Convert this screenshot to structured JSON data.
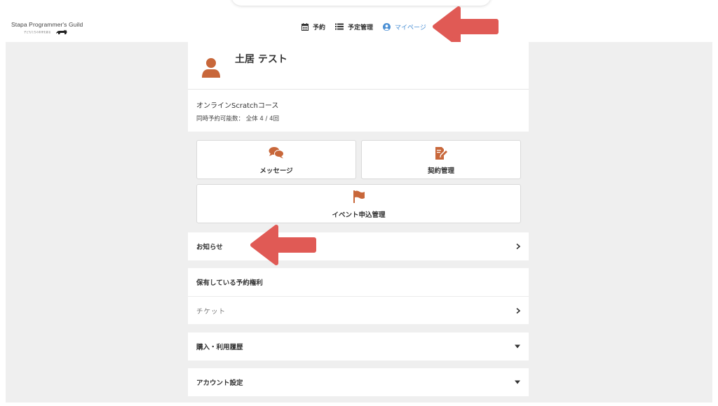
{
  "header": {
    "logo_text": "Stapa Programmer's Guild",
    "logo_sub": "子どもたちの未来を創る",
    "nav": [
      {
        "label": "予約",
        "icon": "calendar-icon"
      },
      {
        "label": "予定管理",
        "icon": "list-icon"
      },
      {
        "label": "マイページ",
        "icon": "user-circle-icon"
      }
    ]
  },
  "profile": {
    "name": "土居 テスト",
    "course": "オンラインScratchコース",
    "limit": "同時予約可能数： 全体 4 / 4回"
  },
  "tiles": [
    {
      "label": "メッセージ",
      "icon": "chat-bubbles-icon"
    },
    {
      "label": "契約管理",
      "icon": "contract-edit-icon"
    },
    {
      "label": "イベント申込管理",
      "icon": "flag-icon"
    }
  ],
  "sections": {
    "notice": "お知らせ",
    "rights_title": "保有している予約権利",
    "ticket": "チケット",
    "history": "購入・利用履歴",
    "account": "アカウント設定"
  },
  "colors": {
    "accent": "#c8673a",
    "active_nav": "#4a8fd4",
    "arrow": "#e05a55",
    "background": "#efefef"
  }
}
